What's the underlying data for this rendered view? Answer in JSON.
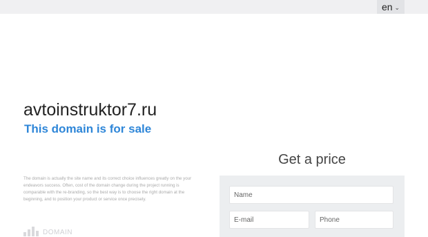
{
  "header": {
    "language": "en",
    "chevron_icon": "chevron-down-icon"
  },
  "hero": {
    "domain": "avtoinstruktor7.ru",
    "tagline": "This domain is for sale"
  },
  "description": "The domain is actually the site name and its correct choice influences greatly on the your endeavors success. Often, cost of the domain change during the project running is comparable with the re-branding, so the best way is to choose the right domain at the beginning, and to position your product or service once precisely.",
  "logo": {
    "text": "DOMAIN",
    "icon": "bars-logo-icon"
  },
  "form": {
    "title": "Get a price",
    "name_placeholder": "Name",
    "email_placeholder": "E-mail",
    "phone_placeholder": "Phone"
  },
  "colors": {
    "accent": "#2e86d8",
    "topbar": "#f0f0f2",
    "panel": "#eceef0"
  }
}
